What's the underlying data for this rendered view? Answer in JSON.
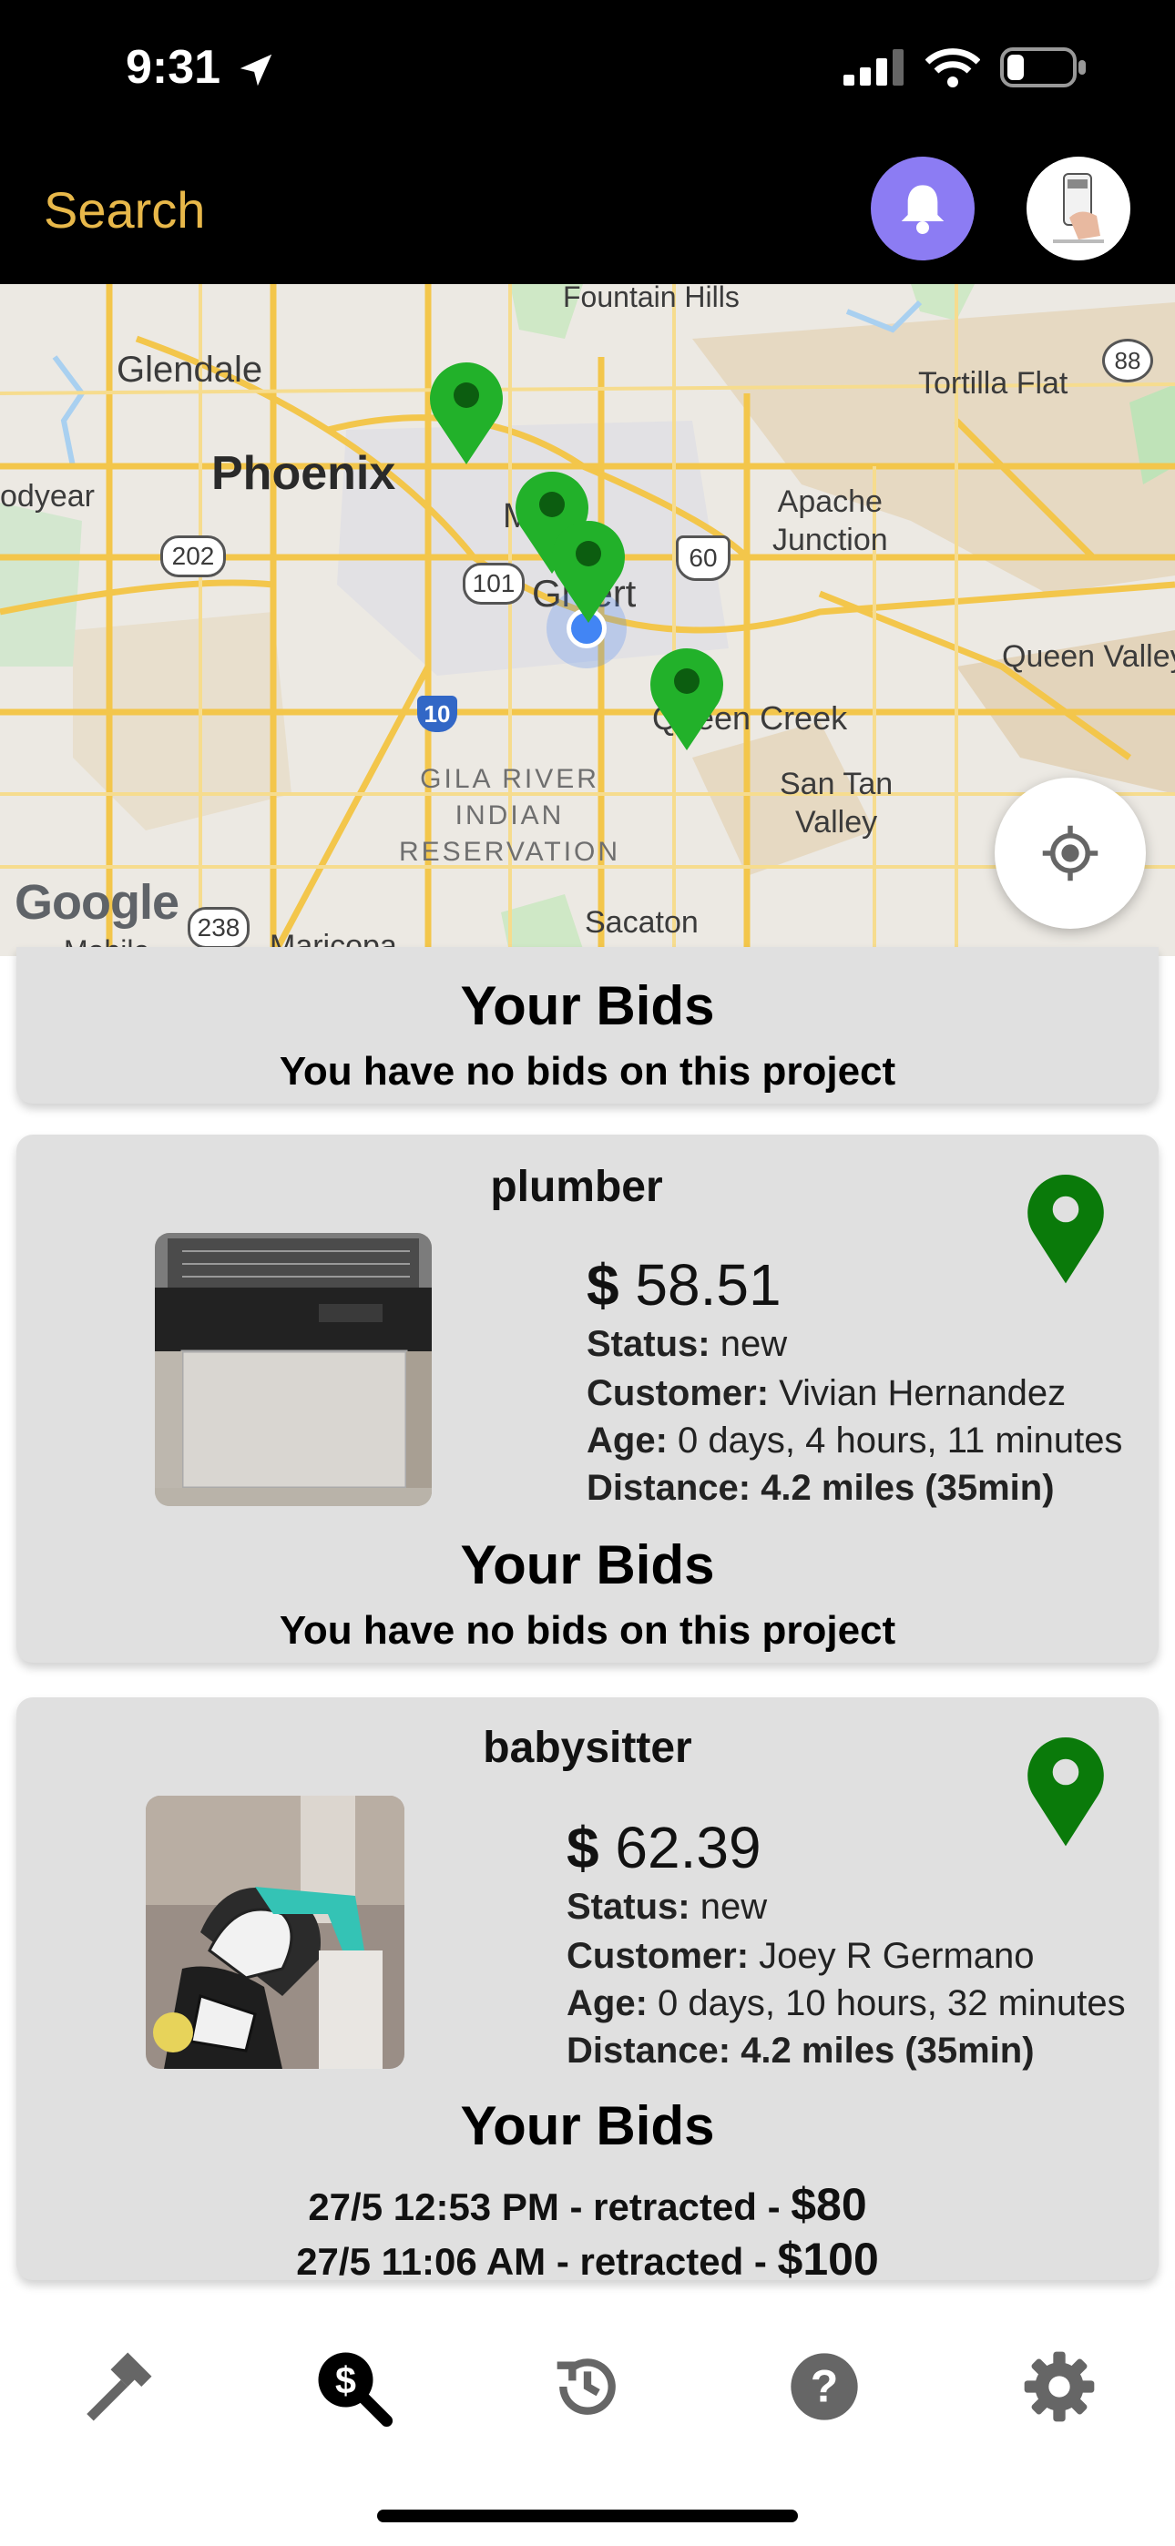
{
  "status_bar": {
    "time": "9:31"
  },
  "header": {
    "search_label": "Search"
  },
  "map": {
    "labels": {
      "fountain_hills": "Fountain Hills",
      "glendale": "Glendale",
      "tortilla_flat": "Tortilla Flat",
      "goodyear": "odyear",
      "phoenix": "Phoenix",
      "mesa": "M",
      "apache_junction": "Apache\nJunction",
      "gilbert": "Gi  ert",
      "queen_valley": "Queen Valley",
      "queen_creek": "Q  een Creek",
      "san_tan_valley": "San Tan\nValley",
      "gila_river": "GILA RIVER\nINDIAN\nRESERVATION",
      "sacaton": "Sacaton",
      "maricopa": "Maricopa",
      "mobile": "Mobile",
      "google": "Google"
    },
    "shields": {
      "r202": "202",
      "r101": "101",
      "r60": "60",
      "r10": "10",
      "r88": "88",
      "r238": "238"
    }
  },
  "cards": [
    {
      "bids_title": "Your Bids",
      "no_bids": "You have no bids on this project"
    },
    {
      "job": "plumber",
      "price_symbol": "$",
      "price": "58.51",
      "status_label": "Status:",
      "status": "new",
      "customer_label": "Customer:",
      "customer": "Vivian Hernandez",
      "age_label": "Age:",
      "age": "0 days, 4 hours, 11 minutes",
      "distance_label": "Distance:",
      "distance": "4.2 miles (35min)",
      "bids_title": "Your Bids",
      "no_bids": "You have no bids on this project"
    },
    {
      "job": "babysitter",
      "price_symbol": "$",
      "price": "62.39",
      "status_label": "Status:",
      "status": "new",
      "customer_label": "Customer:",
      "customer": "Joey R Germano",
      "age_label": "Age:",
      "age": "0 days, 10 hours, 32 minutes",
      "distance_label": "Distance:",
      "distance": "4.2 miles (35min)",
      "bids_title": "Your Bids",
      "bids": [
        {
          "when": "27/5 12:53 PM - retracted - ",
          "amount": "$80"
        },
        {
          "when": "27/5 11:06 AM - retracted - ",
          "amount": "$100"
        }
      ]
    }
  ],
  "colors": {
    "accent_search": "#e8b84a",
    "bell_bg": "#8c7cf3",
    "pin_green": "#0a7a0a",
    "map_pin": "#22b12a",
    "card_bg": "#e0e0e0"
  },
  "icons": [
    "location-arrow-icon",
    "signal-icon",
    "wifi-icon",
    "battery-icon",
    "bell-icon",
    "locate-icon",
    "map-pin-icon",
    "hammer-icon",
    "search-dollar-icon",
    "history-icon",
    "help-icon",
    "gear-icon"
  ]
}
